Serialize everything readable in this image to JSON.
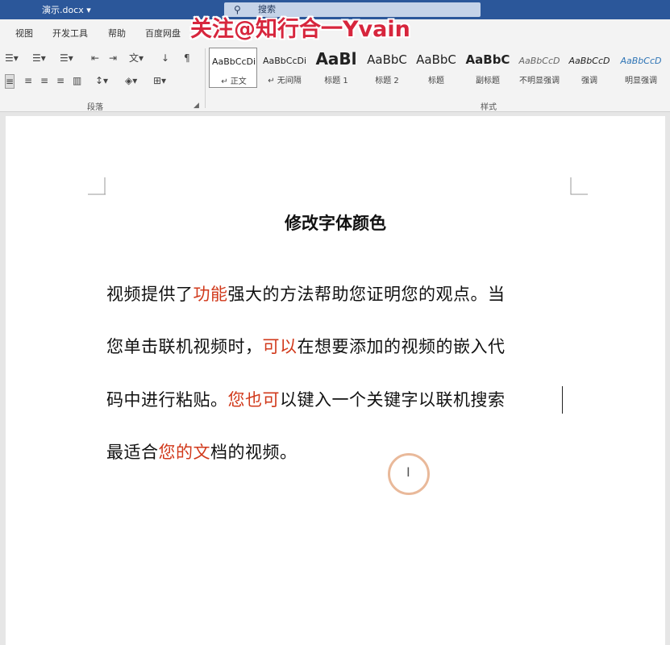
{
  "titlebar": {
    "doc_title": "演示.docx ▾",
    "search_label": "搜索",
    "search_icon": "search-icon"
  },
  "watermark": "关注@知行合一Yvain",
  "menu": [
    "视图",
    "开发工具",
    "帮助",
    "百度网盘"
  ],
  "ribbon": {
    "paragraph_label": "段落",
    "styles_label": "样式",
    "styles": [
      {
        "sample": "AaBbCcDi",
        "name": "↵ 正文"
      },
      {
        "sample": "AaBbCcDi",
        "name": "↵ 无间隔"
      },
      {
        "sample": "AaBl",
        "name": "标题 1"
      },
      {
        "sample": "AaBbC",
        "name": "标题 2"
      },
      {
        "sample": "AaBbC",
        "name": "标题"
      },
      {
        "sample": "AaBbC",
        "name": "副标题"
      },
      {
        "sample": "AaBbCcD",
        "name": "不明显强调"
      },
      {
        "sample": "AaBbCcD",
        "name": "强调"
      },
      {
        "sample": "AaBbCcD",
        "name": "明显强调"
      }
    ]
  },
  "document": {
    "heading": "修改字体颜色",
    "line1": {
      "a": "视频提供了",
      "b": "功能",
      "c": "强大的方法帮助您证明您的观点。当"
    },
    "line2": {
      "a": "您单击联机视频时，",
      "b": "可以",
      "c": "在想要添加的视频的嵌入代"
    },
    "line3": {
      "a": "码中进行粘贴。",
      "b": "您也可",
      "c": "以键入一个关键字以联机搜索"
    },
    "line4": {
      "a": "最适合",
      "b": "您的文",
      "c": "档的视频。"
    }
  },
  "colors": {
    "title_bar": "#2b579a",
    "highlight_red": "#d1391b",
    "watermark_red": "#d7263d"
  }
}
